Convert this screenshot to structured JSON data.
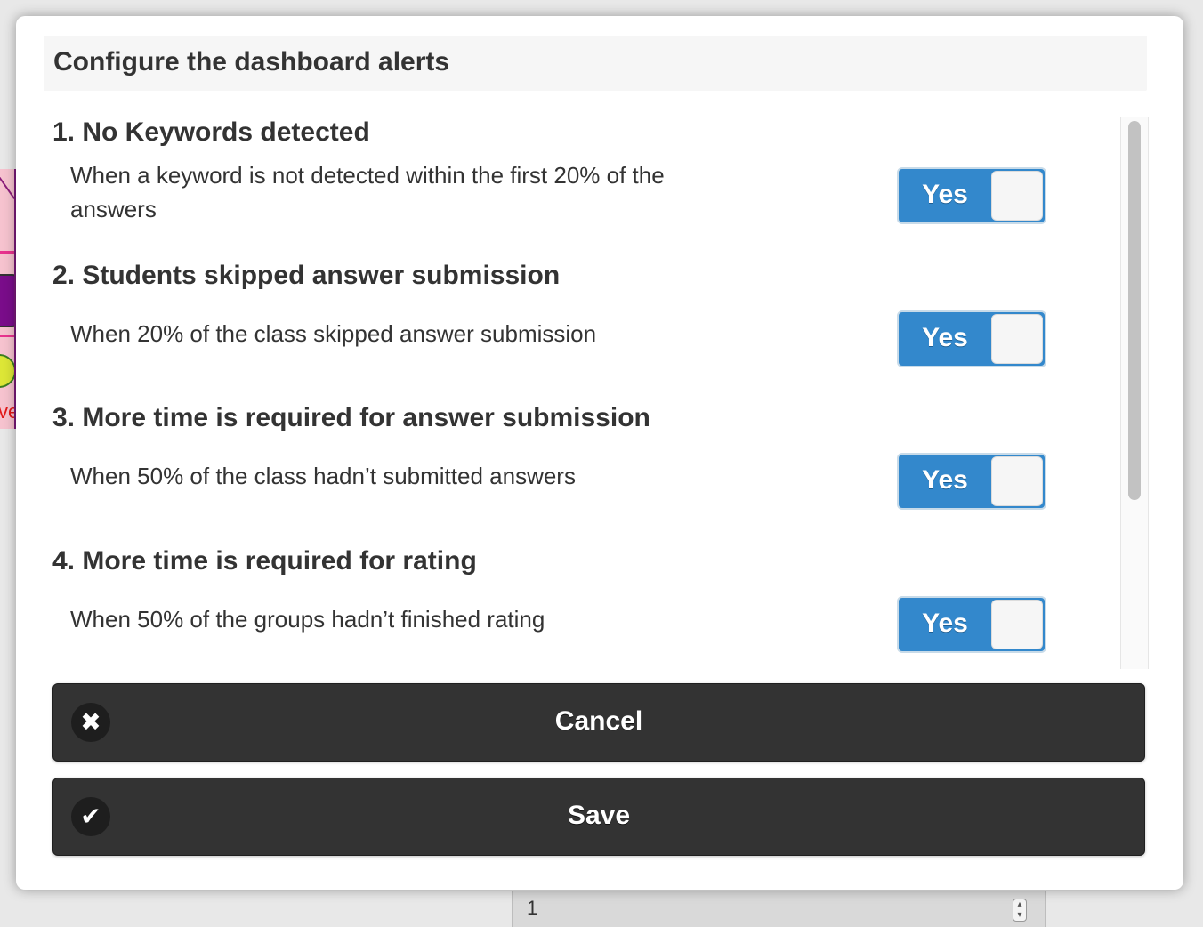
{
  "header": {
    "title": "Configure the dashboard alerts"
  },
  "alerts": [
    {
      "title": "1. No Keywords detected",
      "description": "When a keyword is not detected within the first 20% of the answers",
      "toggle": "Yes"
    },
    {
      "title": "2. Students skipped answer submission",
      "description": "When 20% of the class skipped answer submission",
      "toggle": "Yes"
    },
    {
      "title": "3. More time is required for answer submission",
      "description": "When 50% of the class hadn’t submitted answers",
      "toggle": "Yes"
    },
    {
      "title": "4. More time is required for rating",
      "description": "When 50% of the groups hadn’t finished rating",
      "toggle": "Yes"
    }
  ],
  "buttons": {
    "cancel": "Cancel",
    "save": "Save"
  },
  "icons": {
    "cancel": "close-icon",
    "save": "check-icon"
  },
  "background": {
    "left_text": "ve",
    "bottom_field_value": "1"
  },
  "colors": {
    "toggle_on": "#3388cc",
    "button_bg": "#333333",
    "header_bg": "#f6f6f6"
  }
}
